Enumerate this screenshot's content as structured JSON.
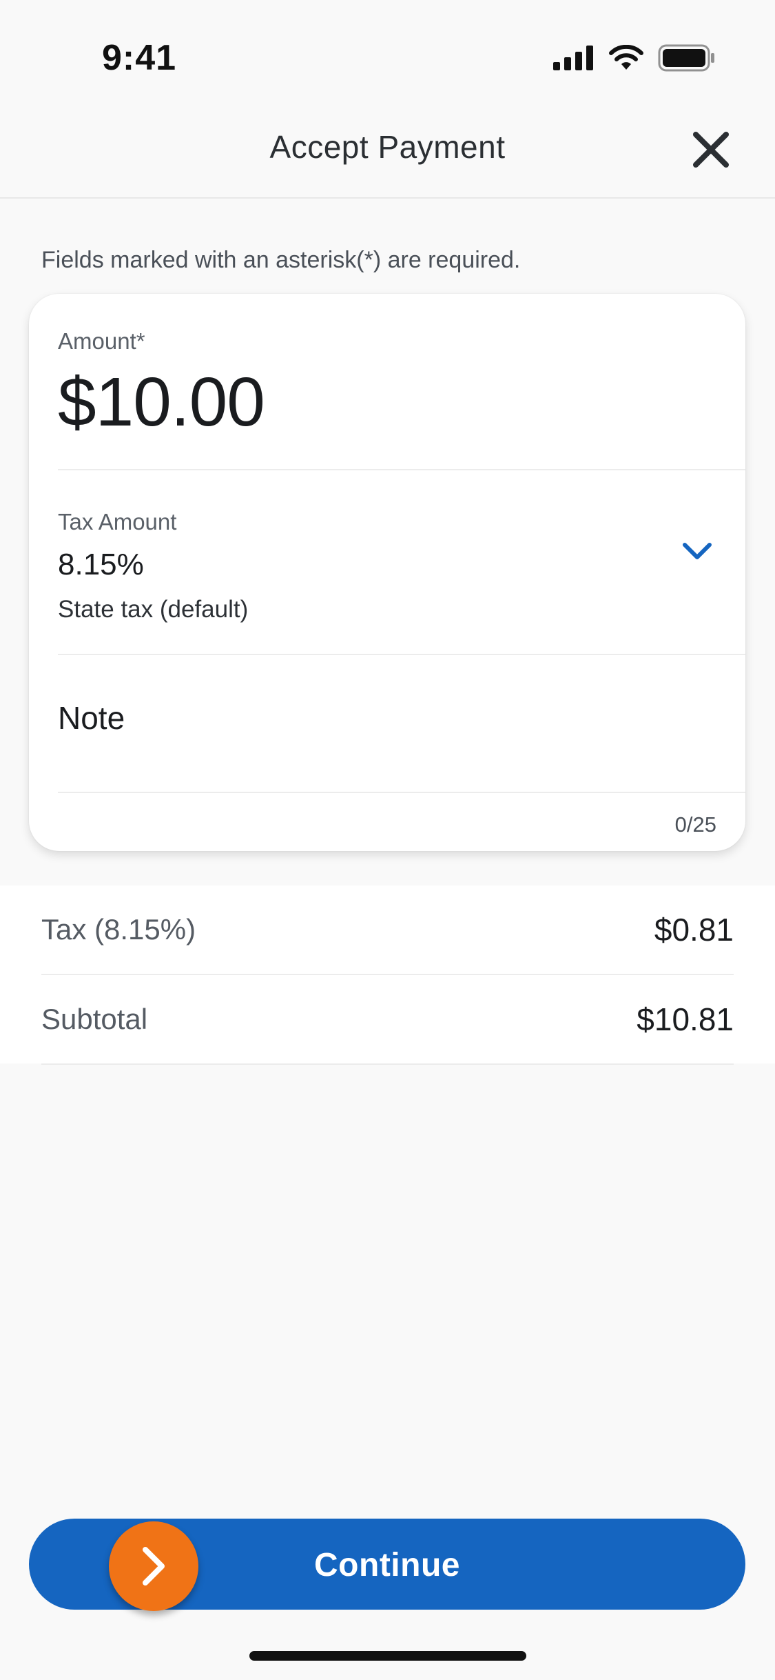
{
  "status_bar": {
    "time": "9:41"
  },
  "header": {
    "title": "Accept Payment",
    "close_icon": "close-icon"
  },
  "form": {
    "required_note": "Fields marked with an asterisk(*) are required.",
    "amount": {
      "label": "Amount*",
      "value": "$10.00"
    },
    "tax": {
      "label": "Tax Amount",
      "value": "8.15%",
      "description": "State tax (default)",
      "dropdown_icon": "chevron-down-icon"
    },
    "note": {
      "placeholder": "Note",
      "value": "",
      "char_count": "0/25"
    }
  },
  "summary": {
    "tax": {
      "label": "Tax (8.15%)",
      "value": "$0.81"
    },
    "subtotal": {
      "label": "Subtotal",
      "value": "$10.81"
    }
  },
  "action": {
    "continue_label": "Continue",
    "handle_icon": "chevron-right-icon"
  },
  "colors": {
    "primary": "#1565c0",
    "accent": "#f07316",
    "background": "#f9f9f9"
  }
}
